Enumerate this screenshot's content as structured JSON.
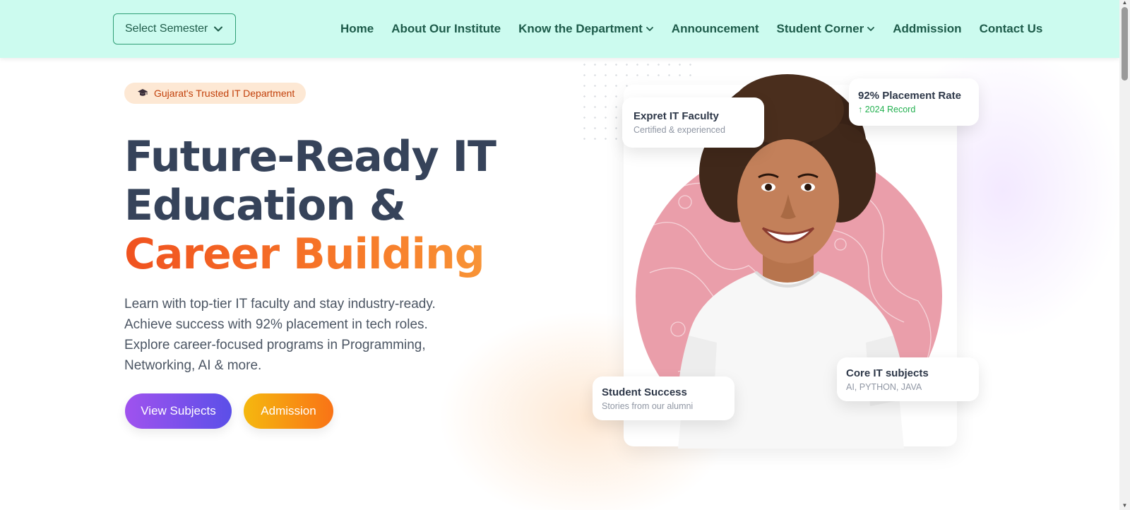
{
  "header": {
    "semester_select": "Select Semester",
    "nav": [
      {
        "label": "Home"
      },
      {
        "label": "About Our Institute"
      },
      {
        "label": "Know the Department",
        "dropdown": true
      },
      {
        "label": "Announcement"
      },
      {
        "label": "Student Corner",
        "dropdown": true
      },
      {
        "label": "Addmission"
      },
      {
        "label": "Contact Us"
      }
    ]
  },
  "hero": {
    "badge": "Gujarat's Trusted IT Department",
    "title_line1": "Future-Ready IT",
    "title_line2": "Education &",
    "title_accent": "Career Building",
    "desc": [
      "Learn with top-tier IT faculty and stay industry-ready.",
      "Achieve success with 92% placement in tech roles.",
      "Explore career-focused programs in Programming,",
      "Networking, AI & more."
    ],
    "btn_subjects": "View Subjects",
    "btn_admission": "Admission"
  },
  "cards": {
    "faculty": {
      "title": "Expret IT Faculty",
      "sub": "Certified & experienced"
    },
    "placement": {
      "title": "92% Placement Rate",
      "sub": "↑ 2024 Record"
    },
    "success": {
      "title": "Student Success",
      "sub": "Stories from our alumni"
    },
    "subjects": {
      "title": "Core IT subjects",
      "sub": "AI, PYTHON, JAVA"
    }
  },
  "colors": {
    "navbar_bg": "#ccfbef",
    "nav_text": "#1d5b4a",
    "title_text": "#36435a",
    "accent_orange": "#f0521f",
    "badge_bg": "#fde8d4",
    "badge_text": "#c2410c",
    "btn_purple": "#8b5cf6",
    "btn_orange": "#f59e0b",
    "photo_circle": "#ea9eaa",
    "success_green": "#22b04f"
  },
  "icons": {
    "semester_chevron": "chevron-down-icon",
    "nav_chevron": "chevron-down-icon",
    "badge_icon": "graduation-cap-icon"
  }
}
